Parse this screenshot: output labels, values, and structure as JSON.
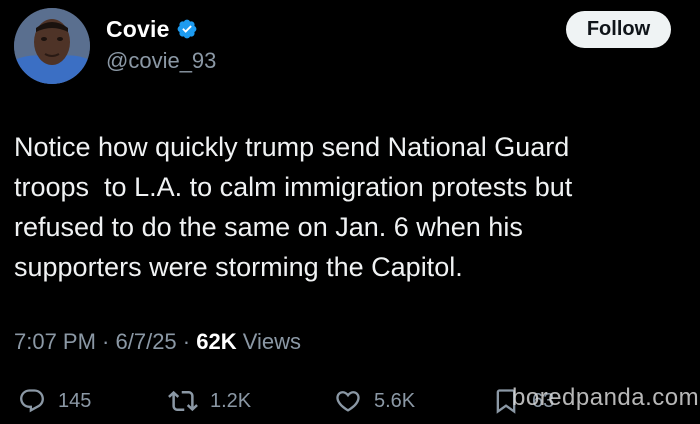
{
  "user": {
    "display_name": "Covie",
    "handle": "@covie_93",
    "verified": true,
    "avatar_icon": "profile-photo"
  },
  "follow_button": {
    "label": "Follow"
  },
  "tweet": {
    "text_lines": [
      "Notice how quickly trump send National Guard",
      "troops  to L.A. to calm immigration protests but",
      "refused to do the same on Jan. 6 when his",
      "supporters were storming the Capitol."
    ]
  },
  "meta": {
    "time": "7:07 PM",
    "sep1": " · ",
    "date": "6/7/25",
    "sep2": " · ",
    "views_count": "62K",
    "views_label": " Views"
  },
  "actions": {
    "reply": {
      "count": "145",
      "icon": "reply-icon"
    },
    "retweet": {
      "count": "1.2K",
      "icon": "retweet-icon"
    },
    "like": {
      "count": "5.6K",
      "icon": "heart-icon"
    },
    "bookmark": {
      "count": "63",
      "icon": "bookmark-icon"
    }
  },
  "watermark": {
    "text": "boredpanda.com"
  },
  "colors": {
    "background": "#000000",
    "text_primary": "#e7e9ea",
    "text_secondary": "#8b98a5",
    "verified_blue": "#1d9bf0",
    "follow_bg": "#eff3f4"
  }
}
